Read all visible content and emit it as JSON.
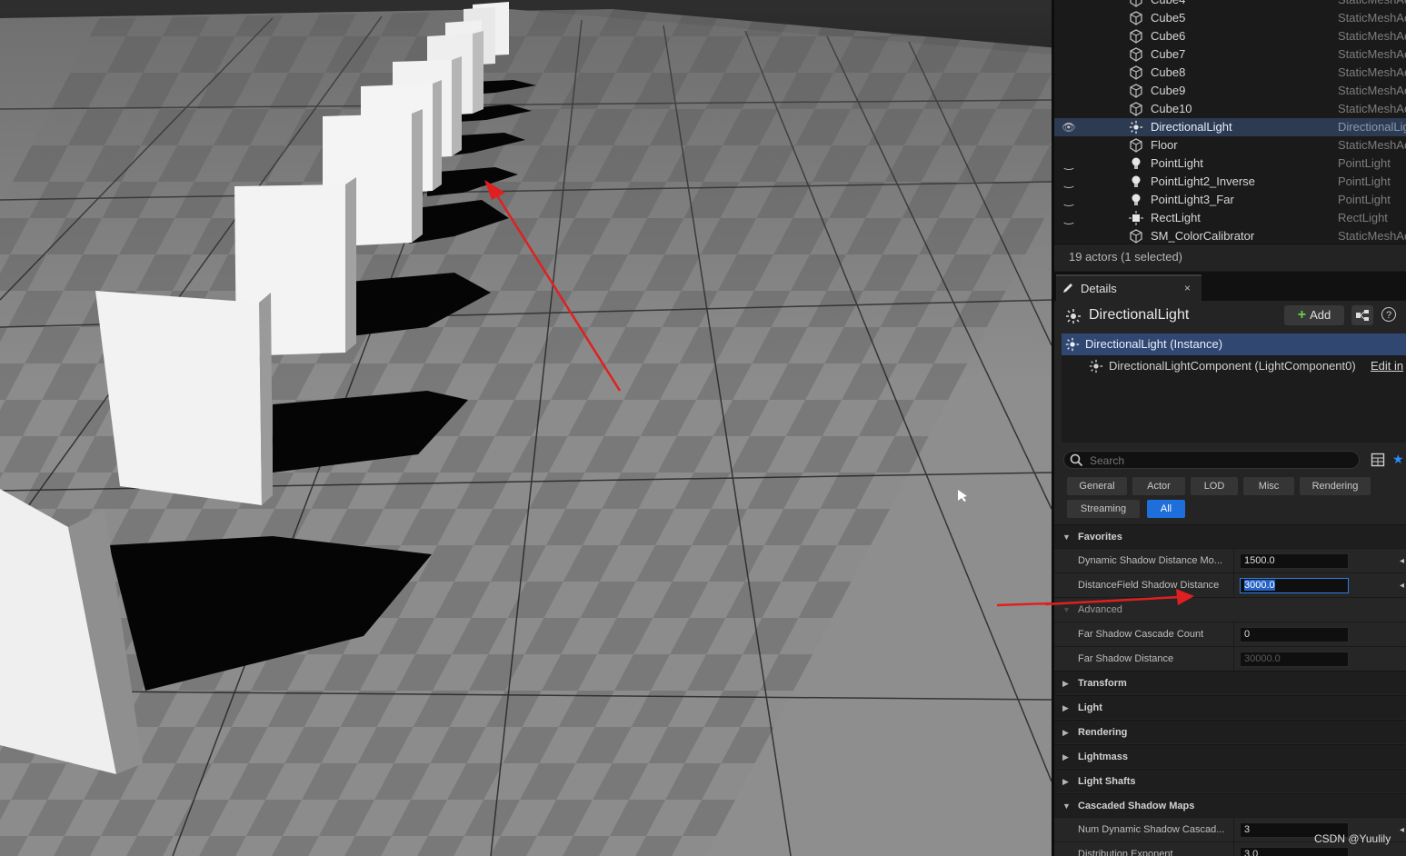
{
  "outliner": {
    "rows": [
      {
        "name": "Cube4",
        "type": "StaticMeshAc",
        "icon": "static-mesh-icon",
        "visibility": ""
      },
      {
        "name": "Cube5",
        "type": "StaticMeshAc",
        "icon": "static-mesh-icon",
        "visibility": ""
      },
      {
        "name": "Cube6",
        "type": "StaticMeshAc",
        "icon": "static-mesh-icon",
        "visibility": ""
      },
      {
        "name": "Cube7",
        "type": "StaticMeshAc",
        "icon": "static-mesh-icon",
        "visibility": ""
      },
      {
        "name": "Cube8",
        "type": "StaticMeshAc",
        "icon": "static-mesh-icon",
        "visibility": ""
      },
      {
        "name": "Cube9",
        "type": "StaticMeshAc",
        "icon": "static-mesh-icon",
        "visibility": ""
      },
      {
        "name": "Cube10",
        "type": "StaticMeshAc",
        "icon": "static-mesh-icon",
        "visibility": ""
      },
      {
        "name": "DirectionalLight",
        "type": "DirectionalLig",
        "icon": "directional-light-icon",
        "visibility": "eye-icon",
        "selected": true
      },
      {
        "name": "Floor",
        "type": "StaticMeshAc",
        "icon": "static-mesh-icon",
        "visibility": ""
      },
      {
        "name": "PointLight",
        "type": "PointLight",
        "icon": "point-light-icon",
        "visibility": "closed-eye-icon"
      },
      {
        "name": "PointLight2_Inverse",
        "type": "PointLight",
        "icon": "point-light-icon",
        "visibility": "closed-eye-icon"
      },
      {
        "name": "PointLight3_Far",
        "type": "PointLight",
        "icon": "point-light-icon",
        "visibility": "closed-eye-icon"
      },
      {
        "name": "RectLight",
        "type": "RectLight",
        "icon": "rect-light-icon",
        "visibility": "closed-eye-icon"
      },
      {
        "name": "SM_ColorCalibrator",
        "type": "StaticMeshAc",
        "icon": "static-mesh-icon",
        "visibility": ""
      }
    ],
    "actor_count": "19 actors (1 selected)"
  },
  "details": {
    "tab_label": "Details",
    "tab_close": "×",
    "actor_name": "DirectionalLight",
    "add_label": "Add",
    "help_label": "?",
    "component_root": "DirectionalLight (Instance)",
    "component_child": "DirectionalLightComponent (LightComponent0)",
    "edit_in_link": "Edit in",
    "search_placeholder": "Search",
    "filter_tabs": [
      "General",
      "Actor",
      "LOD",
      "Misc",
      "Rendering",
      "Streaming",
      "All"
    ],
    "active_filter": "All",
    "sections": {
      "favorites": "Favorites",
      "transform": "Transform",
      "light": "Light",
      "rendering": "Rendering",
      "lightmass": "Lightmass",
      "light_shafts": "Light Shafts",
      "cascaded": "Cascaded Shadow Maps"
    },
    "props": {
      "dynamic_shadow_label": "Dynamic Shadow Distance Mo...",
      "dynamic_shadow_value": "1500.0",
      "df_shadow_label": "DistanceField Shadow Distance",
      "df_shadow_value": "3000.0",
      "advanced_label": "Advanced",
      "far_cascade_label": "Far Shadow Cascade Count",
      "far_cascade_value": "0",
      "far_distance_label": "Far Shadow Distance",
      "far_distance_value": "30000.0",
      "num_dynamic_label": "Num Dynamic Shadow Cascad...",
      "num_dynamic_value": "3",
      "distribution_label": "Distribution Exponent",
      "distribution_value": "3.0"
    }
  },
  "watermark": "CSDN @Yuulily",
  "colors": {
    "selection": "#2f4771",
    "accent": "#1e6fd9",
    "annotation_arrow": "#e02020",
    "add_plus": "#6ccf4a"
  }
}
